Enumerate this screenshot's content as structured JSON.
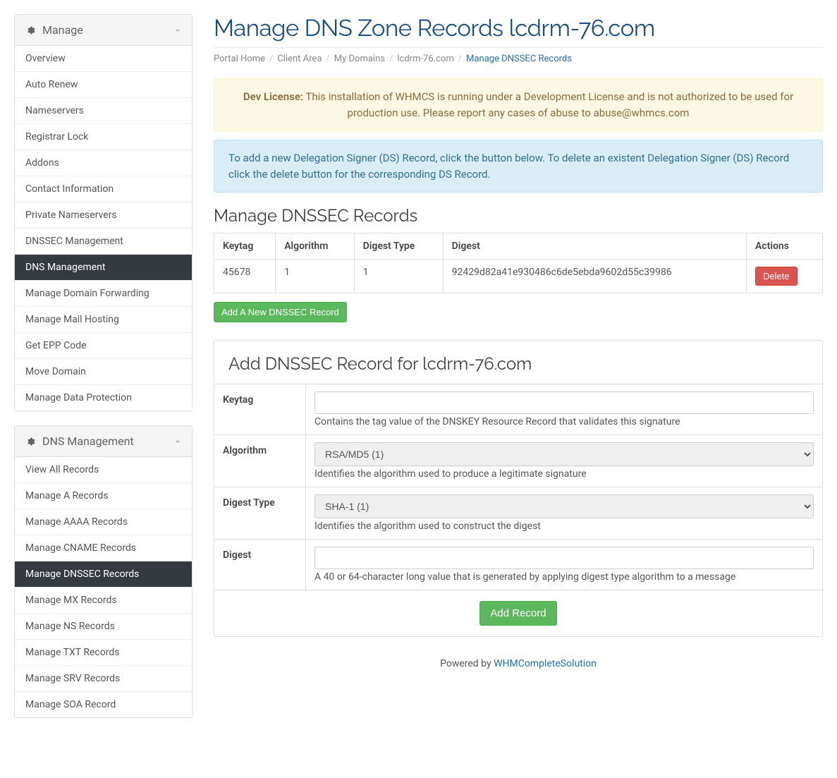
{
  "sidebar": {
    "manage": {
      "title": "Manage",
      "items": [
        {
          "label": "Overview",
          "active": false
        },
        {
          "label": "Auto Renew",
          "active": false
        },
        {
          "label": "Nameservers",
          "active": false
        },
        {
          "label": "Registrar Lock",
          "active": false
        },
        {
          "label": "Addons",
          "active": false
        },
        {
          "label": "Contact Information",
          "active": false
        },
        {
          "label": "Private Nameservers",
          "active": false
        },
        {
          "label": "DNSSEC Management",
          "active": false
        },
        {
          "label": "DNS Management",
          "active": true
        },
        {
          "label": "Manage Domain Forwarding",
          "active": false
        },
        {
          "label": "Manage Mail Hosting",
          "active": false
        },
        {
          "label": "Get EPP Code",
          "active": false
        },
        {
          "label": "Move Domain",
          "active": false
        },
        {
          "label": "Manage Data Protection",
          "active": false
        }
      ]
    },
    "dns": {
      "title": "DNS Management",
      "items": [
        {
          "label": "View All Records",
          "active": false
        },
        {
          "label": "Manage A Records",
          "active": false
        },
        {
          "label": "Manage AAAA Records",
          "active": false
        },
        {
          "label": "Manage CNAME Records",
          "active": false
        },
        {
          "label": "Manage DNSSEC Records",
          "active": true
        },
        {
          "label": "Manage MX Records",
          "active": false
        },
        {
          "label": "Manage NS Records",
          "active": false
        },
        {
          "label": "Manage TXT Records",
          "active": false
        },
        {
          "label": "Manage SRV Records",
          "active": false
        },
        {
          "label": "Manage SOA Record",
          "active": false
        }
      ]
    }
  },
  "page_title": "Manage DNS Zone Records lcdrm-76.com",
  "breadcrumb": {
    "items": [
      "Portal Home",
      "Client Area",
      "My Domains",
      "lcdrm-76.com"
    ],
    "current": "Manage DNSSEC Records"
  },
  "dev_license": {
    "prefix": "Dev License:",
    "text": " This installation of WHMCS is running under a Development License and is not authorized to be used for production use. Please report any cases of abuse to abuse@whmcs.com"
  },
  "info_alert": "To add a new Delegation Signer (DS) Record, click the button below. To delete an existent Delegation Signer (DS) Record click the delete button for the corresponding DS Record.",
  "records": {
    "title": "Manage DNSSEC Records",
    "headers": [
      "Keytag",
      "Algorithm",
      "Digest Type",
      "Digest",
      "Actions"
    ],
    "rows": [
      {
        "keytag": "45678",
        "algorithm": "1",
        "digest_type": "1",
        "digest": "92429d82a41e930486c6de5ebda9602d55c39986",
        "action": "Delete"
      }
    ]
  },
  "add_button": "Add A New DNSSEC Record",
  "form": {
    "title": "Add DNSSEC Record for lcdrm-76.com",
    "keytag": {
      "label": "Keytag",
      "help": "Contains the tag value of the DNSKEY Resource Record that validates this signature"
    },
    "algorithm": {
      "label": "Algorithm",
      "selected": "RSA/MD5 (1)",
      "help": "Identifies the algorithm used to produce a legitimate signature"
    },
    "digest_type": {
      "label": "Digest Type",
      "selected": "SHA-1 (1)",
      "help": "Identifies the algorithm used to construct the digest"
    },
    "digest": {
      "label": "Digest",
      "help": "A 40 or 64-character long value that is generated by applying digest type algorithm to a message"
    },
    "submit": "Add Record"
  },
  "footer": {
    "text": "Powered by ",
    "link": "WHMCompleteSolution"
  }
}
